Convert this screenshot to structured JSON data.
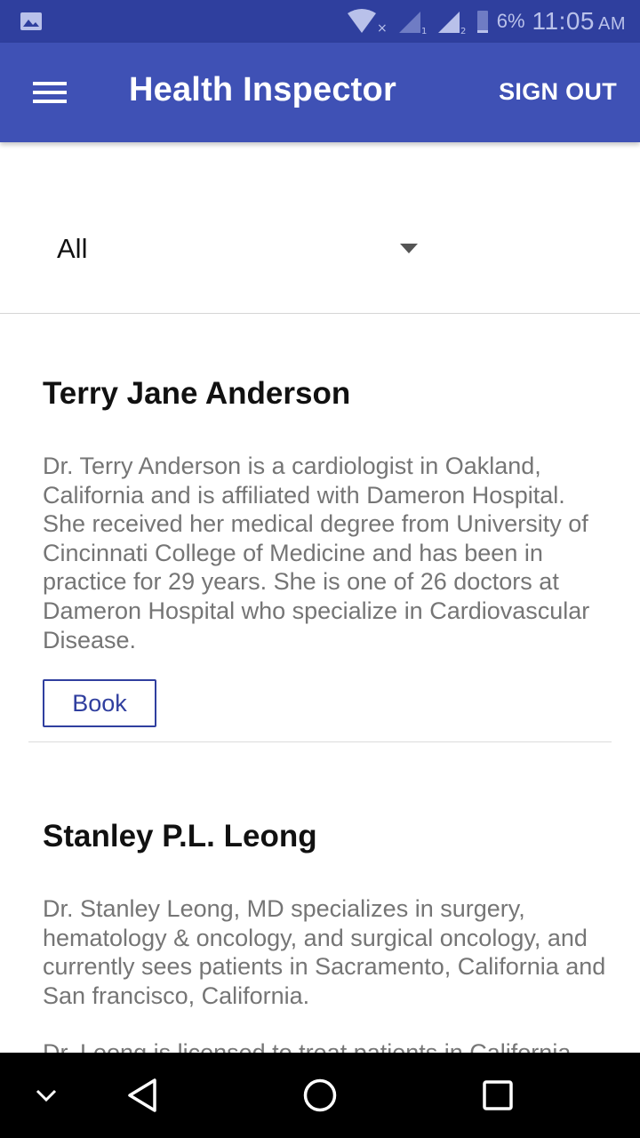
{
  "status_bar": {
    "battery_percent": "6%",
    "time": "11:05",
    "ampm": "AM",
    "icons": [
      "gallery-notification-icon",
      "wifi-icon",
      "signal-sim1-icon",
      "signal-sim2-icon",
      "battery-icon"
    ]
  },
  "app_bar": {
    "title": "Health Inspector",
    "sign_out_label": "SIGN OUT",
    "menu_icon": "hamburger-menu-icon",
    "color": "#3f51b5"
  },
  "filter": {
    "selected": "All"
  },
  "doctors": [
    {
      "name": "Terry Jane Anderson",
      "description": "Dr. Terry Anderson is a cardiologist in Oakland, California and is affiliated with Dameron Hospital. She received her medical degree from University of Cincinnati College of Medicine and has been in practice for 29 years. She is one of 26 doctors at Dameron Hospital who specialize in Cardiovascular Disease.",
      "book_label": "Book"
    },
    {
      "name": "Stanley P.L. Leong",
      "description": "Dr. Stanley Leong, MD specializes in surgery, hematology & oncology, and surgical oncology, and currently sees patients in Sacramento, California and San francisco, California.",
      "description_more": "Dr. Leong is licensed to treat patients in California"
    }
  ],
  "nav_bar": {
    "icons": [
      "collapse-chevron-icon",
      "back-icon",
      "home-icon",
      "recents-icon"
    ]
  },
  "colors": {
    "status_bar": "#2f3f9e",
    "accent": "#303f9f",
    "description_text": "#757575"
  }
}
